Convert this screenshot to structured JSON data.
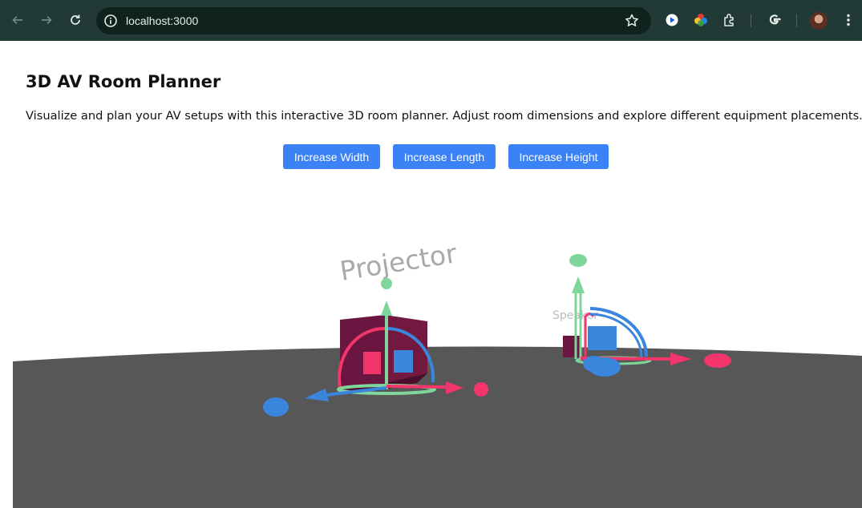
{
  "browser": {
    "url": "localhost:3000"
  },
  "page": {
    "title": "3D AV Room Planner",
    "description": "Visualize and plan your AV setups with this interactive 3D room planner. Adjust room dimensions and explore different equipment placements."
  },
  "controls": {
    "increase_width": "Increase Width",
    "increase_length": "Increase Length",
    "increase_height": "Increase Height"
  },
  "scene": {
    "labels": {
      "projector": "Projector",
      "speaker": "Speaker"
    },
    "colors": {
      "floor": "#575757",
      "equipment_box": "#6b1640",
      "gizmo_x": "#f2356b",
      "gizmo_y": "#7fd69b",
      "gizmo_z": "#3a86dd",
      "button": "#3b82f6"
    }
  }
}
